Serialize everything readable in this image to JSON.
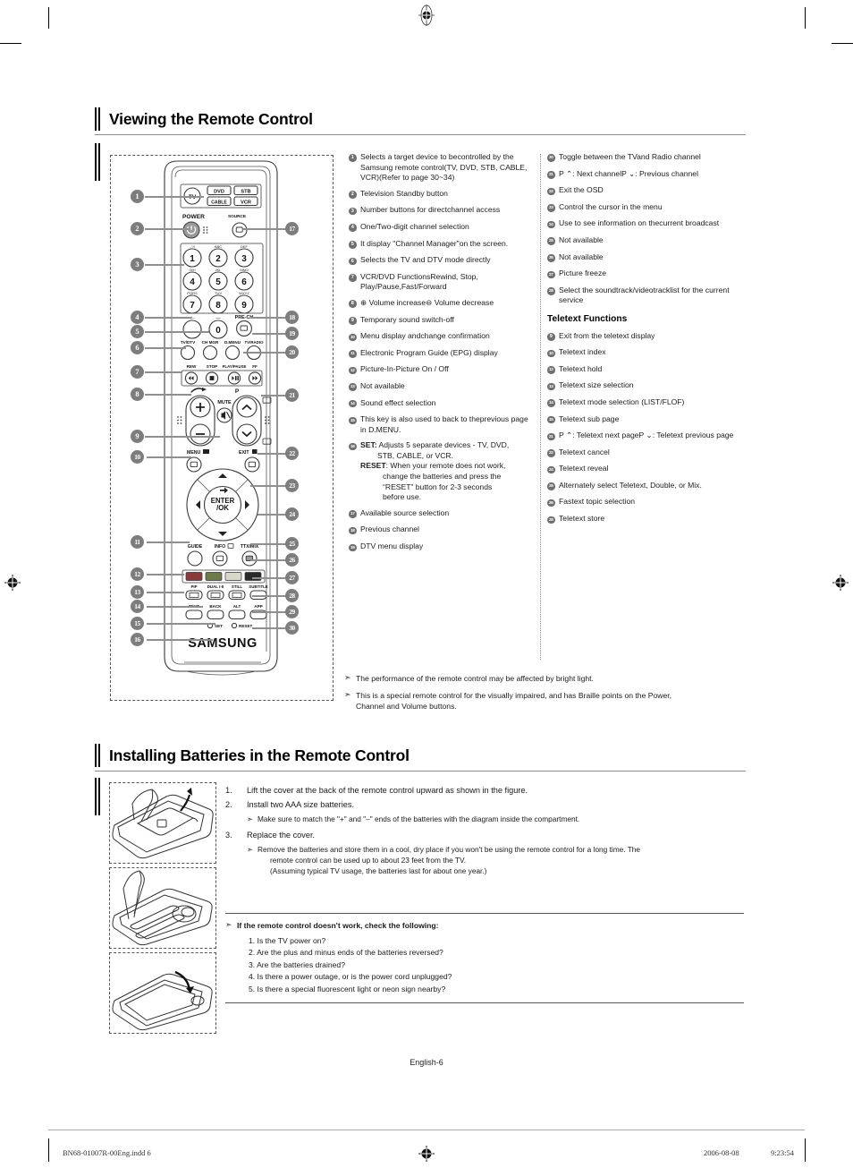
{
  "page": {
    "footer_page_label": "English-6",
    "footer_file": "BN68-01007R-00Eng.indd   6",
    "footer_date": "2006-08-08",
    "footer_time": "9:23:54"
  },
  "section1": {
    "title": "Viewing the Remote Control",
    "remote_brand": "SAMSUNG",
    "remote_labels": {
      "tv": "TV",
      "dvd": "DVD",
      "stb": "STB",
      "cable": "CABLE",
      "vcr": "VCR",
      "power": "POWER",
      "source": "SOURCE",
      "keys_alpha": [
        "-/--",
        "ABC",
        "DEF",
        "GHI",
        "JKL",
        "MNO",
        "PQRS",
        "TUV",
        "WXYZ"
      ],
      "digits": [
        "1",
        "2",
        "3",
        "4",
        "5",
        "6",
        "7",
        "8",
        "9",
        "0"
      ],
      "dash_key": "-/--",
      "underscore_key": "—",
      "pre_ch": "PRE-CH",
      "tv_dtv": "TV/DTV",
      "ch_mgr": "CH MGR",
      "d_menu": "D.MENU",
      "tv_radio": "TV/RADIO",
      "rew": "REW",
      "stop": "STOP",
      "play_pause": "PLAY/PAUSE",
      "ff": "FF",
      "mute": "MUTE",
      "p": "P",
      "menu": "MENU",
      "exit": "EXIT",
      "enter_ok": "ENTER\n/OK",
      "guide": "GUIDE",
      "info": "INFO",
      "ttx_mix": "TTX/MIX",
      "pip": "PIP",
      "dual": "DUAL I-II",
      "still": "STILL",
      "subtitle": "SUBTITLE",
      "text": "TEXT",
      "back": "BACK",
      "alt": "ALT",
      "app": "APP",
      "set": "SET",
      "reset": "RESET"
    },
    "callouts_left": [
      "1",
      "2",
      "3",
      "4",
      "5",
      "6",
      "7",
      "8",
      "9",
      "10",
      "11",
      "12",
      "13",
      "14",
      "15",
      "16"
    ],
    "callouts_right": [
      "17",
      "18",
      "19",
      "20",
      "21",
      "22",
      "23",
      "24",
      "25",
      "26",
      "27",
      "28",
      "29",
      "30"
    ],
    "col_mid": [
      {
        "n": "1",
        "lines": [
          "Selects a target device to be",
          "controlled by the Samsung remote control",
          "(TV, DVD, STB, CABLE, VCR)",
          "(Refer to page 30~34)"
        ]
      },
      {
        "n": "2",
        "lines": [
          "Television Standby button"
        ]
      },
      {
        "n": "3",
        "lines": [
          "Number buttons for direct",
          "channel access"
        ]
      },
      {
        "n": "4",
        "lines": [
          "One/Two-digit channel selection"
        ]
      },
      {
        "n": "5",
        "lines": [
          "It display \"Channel Manager\"",
          "on the screen."
        ]
      },
      {
        "n": "6",
        "lines": [
          "Selects the TV and DTV mode directly"
        ]
      },
      {
        "n": "7",
        "lines": [
          "VCR/DVD Functions",
          "Rewind, Stop, Play/Pause,",
          "Fast/Forward"
        ]
      },
      {
        "n": "8",
        "lines": [
          "⊕ Volume increase",
          "⊖ Volume decrease"
        ]
      },
      {
        "n": "9",
        "lines": [
          "Temporary sound switch-off"
        ]
      },
      {
        "n": "10",
        "lines": [
          "Menu display and",
          "change confirmation"
        ]
      },
      {
        "n": "11",
        "lines": [
          "Electronic Program Guide (EPG) display"
        ]
      },
      {
        "n": "12",
        "lines": [
          "Picture-In-Picture On / Off"
        ]
      },
      {
        "n": "13",
        "lines": [
          "Not available"
        ]
      },
      {
        "n": "14",
        "lines": [
          "Sound effect selection"
        ]
      },
      {
        "n": "15",
        "lines": [
          "This key is also used to back to the",
          "previous page in D.MENU."
        ]
      },
      {
        "n": "16",
        "rich": true,
        "lines": [
          "SET: Adjusts 5 separate devices - TV, DVD,",
          "STB, CABLE, or VCR.",
          "RESET: When your remote does not work,",
          "change the batteries and press the",
          "“RESET” button for 2-3 seconds",
          "before use."
        ]
      },
      {
        "n": "17",
        "lines": [
          "Available source selection"
        ]
      },
      {
        "n": "18",
        "lines": [
          "Previous channel"
        ]
      },
      {
        "n": "19",
        "lines": [
          "DTV menu display"
        ]
      }
    ],
    "col_right": [
      {
        "n": "20",
        "lines": [
          "Toggle between the TV",
          "and Radio channel"
        ]
      },
      {
        "n": "21",
        "lines": [
          "P ⌃: Next channel",
          "P ⌄: Previous channel"
        ]
      },
      {
        "n": "22",
        "lines": [
          "Exit the OSD"
        ]
      },
      {
        "n": "23",
        "lines": [
          "Control the cursor in the menu"
        ]
      },
      {
        "n": "24",
        "lines": [
          "Use to see information on the",
          "current broadcast"
        ]
      },
      {
        "n": "25",
        "lines": [
          "Not available"
        ]
      },
      {
        "n": "26",
        "lines": [
          "Not available"
        ]
      },
      {
        "n": "27",
        "lines": [
          "Picture freeze"
        ]
      },
      {
        "n": "28",
        "lines": [
          "Select the soundtrack/videotrack",
          "list for the current service"
        ]
      }
    ],
    "teletext_heading": "Teletext Functions",
    "col_teletext": [
      {
        "n": "9",
        "lines": [
          "Exit from the teletext display"
        ]
      },
      {
        "n": "10",
        "lines": [
          "Teletext index"
        ]
      },
      {
        "n": "12",
        "lines": [
          "Teletext hold"
        ]
      },
      {
        "n": "13",
        "lines": [
          "Teletext size selection"
        ]
      },
      {
        "n": "14",
        "lines": [
          "Teletext mode selection (LIST/FLOF)"
        ]
      },
      {
        "n": "15",
        "lines": [
          "Teletext sub page"
        ]
      },
      {
        "n": "21",
        "lines": [
          "P ⌃: Teletext next page",
          "P ⌄: Teletext previous page"
        ]
      },
      {
        "n": "22",
        "lines": [
          "Teletext cancel"
        ]
      },
      {
        "n": "24",
        "lines": [
          "Teletext reveal"
        ]
      },
      {
        "n": "25",
        "lines": [
          "Alternately select Teletext, Double, or Mix."
        ]
      },
      {
        "n": "26",
        "lines": [
          "Fastext topic selection"
        ]
      },
      {
        "n": "28",
        "lines": [
          "Teletext store"
        ]
      }
    ],
    "notes": [
      [
        "The performance of the remote control may be affected by bright light."
      ],
      [
        "This is a special remote control for the visually impaired, and has Braille points on the Power,",
        "Channel and Volume buttons."
      ]
    ]
  },
  "section2": {
    "title": "Installing Batteries in the Remote Control",
    "steps": [
      {
        "n": "1.",
        "text": "Lift the cover at the back of the remote control upward as shown in the figure.",
        "subs": []
      },
      {
        "n": "2.",
        "text": "Install two AAA size batteries.",
        "subs": [
          [
            "Make sure to match the \"+\" and \"–\" ends of the batteries with the diagram inside the compartment."
          ]
        ]
      },
      {
        "n": "3.",
        "text": "Replace the cover.",
        "subs": [
          [
            "Remove the batteries and store them in a cool, dry place if you won't be using the remote control for a long time. The",
            "remote control can be used up to about 23 feet from the TV.",
            "(Assuming typical TV usage, the batteries last for about one year.)"
          ]
        ]
      }
    ],
    "checklist_title": "If the remote control doesn't work, check the following:",
    "checklist": [
      "1. Is the TV power on?",
      "2. Are the plus and minus ends of the batteries reversed?",
      "3. Are the batteries drained?",
      "4. Is there a power outage, or is the power cord unplugged?",
      "5. Is there a special fluorescent light or neon sign nearby?"
    ]
  },
  "colors": {
    "callout_gray": "#7d7d7d",
    "rule_gray": "#8c8c8c",
    "button_red": "#8a3a3a",
    "button_green": "#6e7a4a",
    "button_yellow": "#d8d8c8",
    "button_blue": "#2a2a2a"
  }
}
